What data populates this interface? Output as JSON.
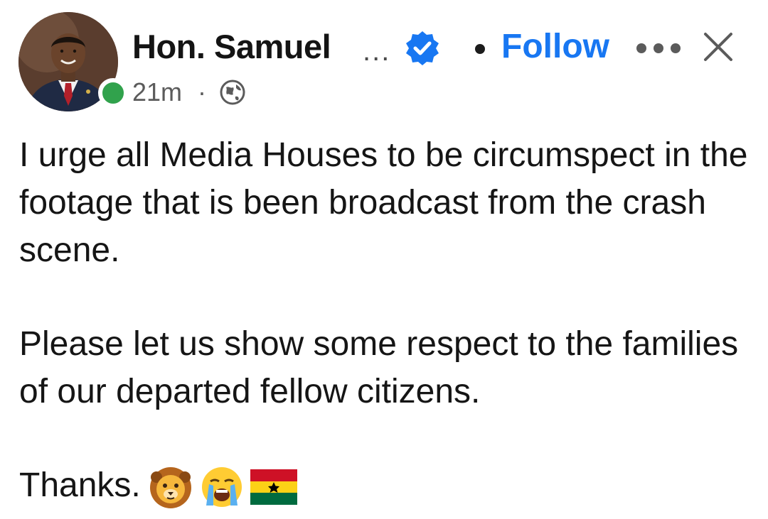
{
  "post": {
    "author": {
      "name": "Hon. Samuel",
      "name_truncation": "...",
      "verified": true,
      "online": true,
      "avatar_icon": "profile-photo"
    },
    "follow_dot": "•",
    "follow_label": "Follow",
    "timestamp": "21m",
    "meta_separator": "·",
    "audience_icon": "globe-icon",
    "body": {
      "paragraph_1": "I urge all Media Houses to be circumspect in the footage that is been broadcast from the crash scene.",
      "paragraph_2": "Please let us show some respect to the families of our departed fellow citizens.",
      "paragraph_3": "Thanks."
    },
    "emojis": [
      "lion-face-emoji",
      "loudly-crying-face-emoji",
      "ghana-flag-emoji"
    ]
  },
  "colors": {
    "accent_blue": "#1877f2",
    "online_green": "#31a24c",
    "text_primary": "#151515",
    "text_secondary": "#5b5b5b"
  }
}
